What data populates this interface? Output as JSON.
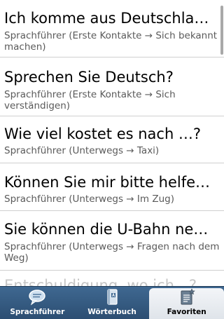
{
  "list": {
    "items": [
      {
        "title": "Ich komme aus Deutschla…",
        "subtitle": "Sprachführer (Erste Kontakte → Sich bekannt machen)"
      },
      {
        "title": "Sprechen Sie Deutsch?",
        "subtitle": "Sprachführer (Erste Kontakte → Sich verständigen)"
      },
      {
        "title": "Wie viel kostet es nach …?",
        "subtitle": "Sprachführer (Unterwegs → Taxi)"
      },
      {
        "title": "Können Sie mir bitte helfe…",
        "subtitle": "Sprachführer (Unterwegs → Im Zug)"
      },
      {
        "title": "Sie können die U-Bahn ne…",
        "subtitle": "Sprachführer (Unterwegs → Fragen nach dem Weg)"
      },
      {
        "title": "Entschuldigung, wo ich…?",
        "subtitle": ""
      }
    ]
  },
  "tabbar": {
    "tabs": [
      {
        "label": "Sprachführer",
        "icon": "speech-bubble-icon",
        "selected": false
      },
      {
        "label": "Wörterbuch",
        "icon": "dictionary-book-icon",
        "selected": false
      },
      {
        "label": "Favoriten",
        "icon": "favorites-document-icon",
        "selected": true
      }
    ],
    "colors": {
      "bar": "#2f5479",
      "selected": "#eef1f5"
    }
  }
}
